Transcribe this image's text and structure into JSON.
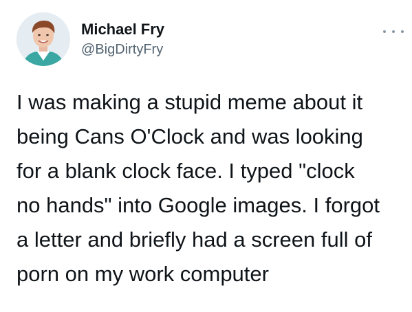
{
  "author": {
    "display_name": "Michael Fry",
    "handle": "@BigDirtyFry",
    "avatar": "profile-photo"
  },
  "tweet": {
    "lines": [
      "I was making a stupid meme about it",
      "being Cans O'Clock and was looking",
      "for a blank clock face. I typed \"clock",
      "no hands\" into Google images. I forgot",
      "a letter and briefly had a screen full of",
      "porn on my work computer"
    ]
  },
  "menu": {
    "icon": "more-horizontal-icon"
  },
  "colors": {
    "text": "#0f1419",
    "secondary": "#536471",
    "icon": "#8b98a5",
    "background": "#ffffff"
  }
}
